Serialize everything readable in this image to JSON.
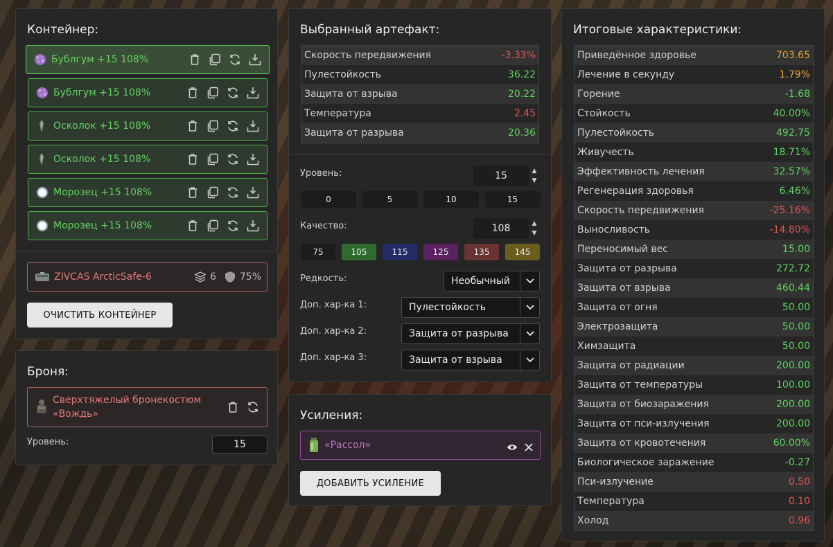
{
  "container": {
    "title": "Контейнер:",
    "items": [
      {
        "label": "Бублгум +15 108%",
        "icon": "bubblegum-icon",
        "selected": true
      },
      {
        "label": "Бублгум +15 108%",
        "icon": "bubblegum-icon",
        "selected": false
      },
      {
        "label": "Осколок +15 108%",
        "icon": "shard-icon",
        "selected": false
      },
      {
        "label": "Осколок +15 108%",
        "icon": "shard-icon",
        "selected": false
      },
      {
        "label": "Морозец +15 108%",
        "icon": "frost-icon",
        "selected": false
      },
      {
        "label": "Морозец +15 108%",
        "icon": "frost-icon",
        "selected": false
      }
    ],
    "case": {
      "name": "ZIVCAS ArcticSafe-6",
      "slots": "6",
      "protection": "75%"
    },
    "clear_button": "ОЧИСТИТЬ КОНТЕЙНЕР"
  },
  "armor": {
    "title": "Броня:",
    "name_line1": "Сверхтяжелый бронекостюм",
    "name_line2": "«Вождь»",
    "level_label": "Уровень:",
    "level_value": "15"
  },
  "artifact": {
    "title": "Выбранный артефакт:",
    "stats": [
      {
        "name": "Скорость передвижения",
        "value": "-3.33%",
        "color": "red"
      },
      {
        "name": "Пулестойкость",
        "value": "36.22",
        "color": "green"
      },
      {
        "name": "Защита от взрыва",
        "value": "20.22",
        "color": "green"
      },
      {
        "name": "Температура",
        "value": "2.45",
        "color": "red"
      },
      {
        "name": "Защита от разрыва",
        "value": "20.36",
        "color": "green"
      }
    ],
    "level_label": "Уровень:",
    "level_value": "15",
    "level_presets": [
      "0",
      "5",
      "10",
      "15"
    ],
    "quality_label": "Качество:",
    "quality_value": "108",
    "quality_presets": [
      {
        "label": "75",
        "color": "#1c1c1c"
      },
      {
        "label": "105",
        "color": "#2f6b2f"
      },
      {
        "label": "115",
        "color": "#232a66"
      },
      {
        "label": "125",
        "color": "#5a2160"
      },
      {
        "label": "135",
        "color": "#6b3232"
      },
      {
        "label": "145",
        "color": "#6b5e1c"
      }
    ],
    "rarity_label": "Редкость:",
    "rarity_value": "Необычный",
    "extra1_label": "Доп. хар-ка 1:",
    "extra1_value": "Пулестойкость",
    "extra2_label": "Доп. хар-ка 2:",
    "extra2_value": "Защита от разрыва",
    "extra3_label": "Доп. хар-ка 3:",
    "extra3_value": "Защита от взрыва"
  },
  "boosts": {
    "title": "Усиления:",
    "item": "«Рассол»",
    "add_button": "ДОБАВИТЬ УСИЛЕНИЕ"
  },
  "totals": {
    "title": "Итоговые характеристики:",
    "stats": [
      {
        "name": "Приведённое здоровье",
        "value": "703.65",
        "color": "orange"
      },
      {
        "name": "Лечение в секунду",
        "value": "1.79%",
        "color": "orange"
      },
      {
        "name": "Горение",
        "value": "-1.68",
        "color": "green"
      },
      {
        "name": "Стойкость",
        "value": "40.00%",
        "color": "green"
      },
      {
        "name": "Пулестойкость",
        "value": "492.75",
        "color": "green"
      },
      {
        "name": "Живучесть",
        "value": "18.71%",
        "color": "green"
      },
      {
        "name": "Эффективность лечения",
        "value": "32.57%",
        "color": "green"
      },
      {
        "name": "Регенерация здоровья",
        "value": "6.46%",
        "color": "green"
      },
      {
        "name": "Скорость передвижения",
        "value": "-25.16%",
        "color": "red"
      },
      {
        "name": "Выносливость",
        "value": "-14.80%",
        "color": "red"
      },
      {
        "name": "Переносимый вес",
        "value": "15.00",
        "color": "green"
      },
      {
        "name": "Защита от разрыва",
        "value": "272.72",
        "color": "green"
      },
      {
        "name": "Защита от взрыва",
        "value": "460.44",
        "color": "green"
      },
      {
        "name": "Защита от огня",
        "value": "50.00",
        "color": "green"
      },
      {
        "name": "Электрозащита",
        "value": "50.00",
        "color": "green"
      },
      {
        "name": "Химзащита",
        "value": "50.00",
        "color": "green"
      },
      {
        "name": "Защита от радиации",
        "value": "200.00",
        "color": "green"
      },
      {
        "name": "Защита от температуры",
        "value": "100.00",
        "color": "green"
      },
      {
        "name": "Защита от биозаражения",
        "value": "200.00",
        "color": "green"
      },
      {
        "name": "Защита от пси-излучения",
        "value": "200.00",
        "color": "green"
      },
      {
        "name": "Защита от кровотечения",
        "value": "60.00%",
        "color": "green"
      },
      {
        "name": "Биологическое заражение",
        "value": "-0.27",
        "color": "green"
      },
      {
        "name": "Пси-излучение",
        "value": "0.50",
        "color": "red"
      },
      {
        "name": "Температура",
        "value": "0.10",
        "color": "red"
      },
      {
        "name": "Холод",
        "value": "0.96",
        "color": "red"
      }
    ]
  }
}
